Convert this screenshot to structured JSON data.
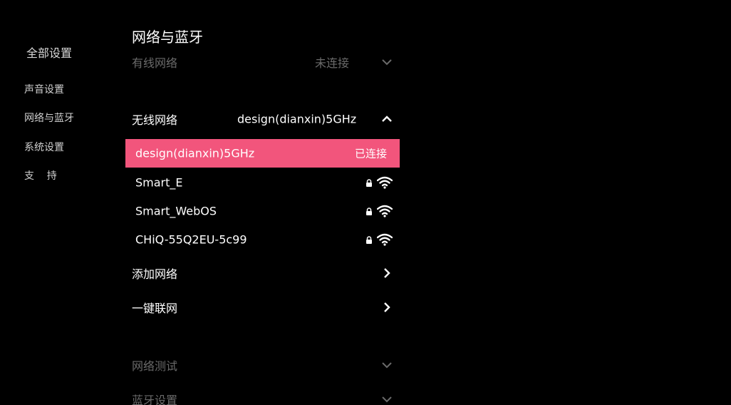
{
  "sidebar": {
    "title": "全部设置",
    "items": [
      {
        "label": "声音设置"
      },
      {
        "label": "网络与蓝牙"
      },
      {
        "label": "系统设置"
      },
      {
        "label": "支    持"
      }
    ]
  },
  "main": {
    "title": "网络与蓝牙",
    "wired": {
      "label": "有线网络",
      "value": "未连接",
      "icon": "chevron-down-icon"
    },
    "wireless": {
      "label": "无线网络",
      "value": "design(dianxin)5GHz",
      "icon": "chevron-up-icon"
    },
    "networks": [
      {
        "name": "design(dianxin)5GHz",
        "status": "已连接",
        "selected": true
      },
      {
        "name": "Smart_E",
        "locked": true,
        "icon": "wifi-icon"
      },
      {
        "name": "Smart_WebOS",
        "locked": true,
        "icon": "wifi-icon"
      },
      {
        "name": "CHiQ-55Q2EU-5c99",
        "locked": true,
        "icon": "wifi-icon"
      }
    ],
    "add_network": {
      "label": "添加网络",
      "icon": "chevron-right-icon"
    },
    "one_key": {
      "label": "一键联网",
      "icon": "chevron-right-icon"
    },
    "network_test": {
      "label": "网络测试",
      "icon": "chevron-down-icon"
    },
    "bluetooth": {
      "label": "蓝牙设置",
      "icon": "chevron-down-icon"
    }
  },
  "colors": {
    "background": "#000000",
    "accent": "#f2557c",
    "dim_text": "#6a6a6a"
  }
}
